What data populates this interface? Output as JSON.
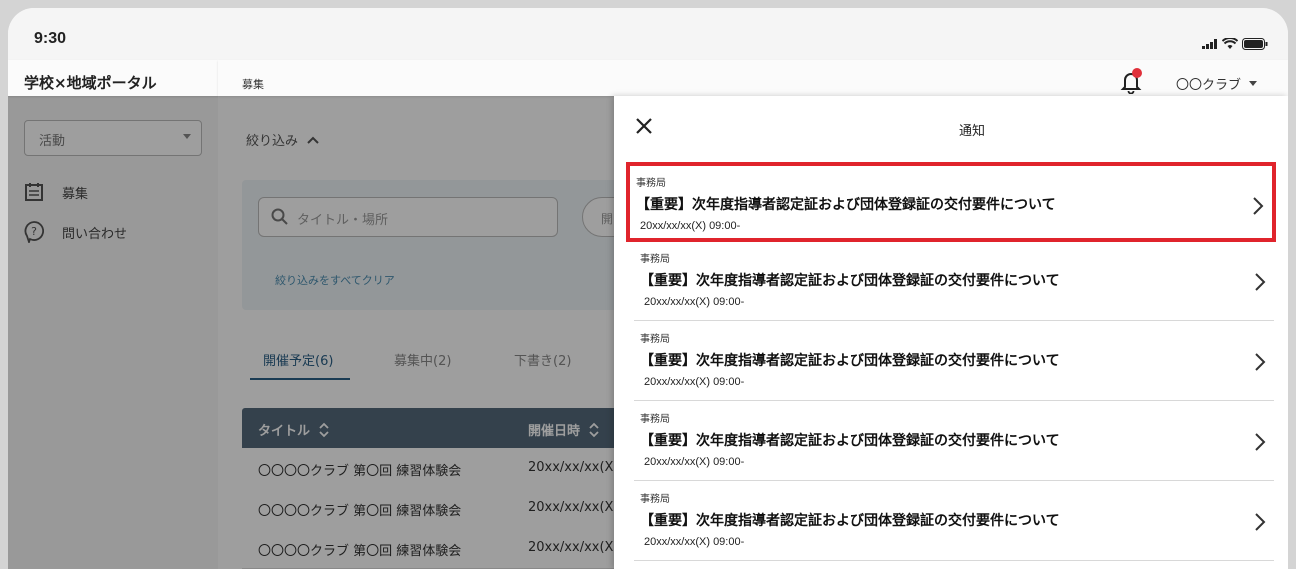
{
  "status_bar": {
    "time": "9:30"
  },
  "app": {
    "title": "学校×地域ポータル"
  },
  "sidebar": {
    "select_value": "活動",
    "items": [
      {
        "label": "募集",
        "icon": "calendar-icon"
      },
      {
        "label": "問い合わせ",
        "icon": "help-circle-icon"
      }
    ]
  },
  "header": {
    "breadcrumb": "募集",
    "account": "〇〇クラブ"
  },
  "filter": {
    "toggle_label": "絞り込み",
    "search_placeholder": "タイトル・場所",
    "pill_label": "開",
    "clear_label": "絞り込みをすべてクリア"
  },
  "tabs": [
    {
      "label": "開催予定(6)",
      "active": true
    },
    {
      "label": "募集中(2)",
      "active": false
    },
    {
      "label": "下書き(2)",
      "active": false
    }
  ],
  "table": {
    "headers": [
      "タイトル",
      "開催日時"
    ],
    "rows": [
      [
        "〇〇〇〇クラブ 第〇回 練習体験会",
        "20xx/xx/xx(X"
      ],
      [
        "〇〇〇〇クラブ 第〇回 練習体験会",
        "20xx/xx/xx(X"
      ],
      [
        "〇〇〇〇クラブ 第〇回 練習体験会",
        "20xx/xx/xx(X"
      ]
    ]
  },
  "notification_panel": {
    "title": "通知",
    "items": [
      {
        "source": "事務局",
        "title": "【重要】次年度指導者認定証および団体登録証の交付要件について",
        "date": "20xx/xx/xx(X) 09:00-",
        "selected": true
      },
      {
        "source": "事務局",
        "title": "【重要】次年度指導者認定証および団体登録証の交付要件について",
        "date": "20xx/xx/xx(X) 09:00-",
        "selected": false
      },
      {
        "source": "事務局",
        "title": "【重要】次年度指導者認定証および団体登録証の交付要件について",
        "date": "20xx/xx/xx(X) 09:00-",
        "selected": false
      },
      {
        "source": "事務局",
        "title": "【重要】次年度指導者認定証および団体登録証の交付要件について",
        "date": "20xx/xx/xx(X) 09:00-",
        "selected": false
      },
      {
        "source": "事務局",
        "title": "【重要】次年度指導者認定証および団体登録証の交付要件について",
        "date": "20xx/xx/xx(X) 09:00-",
        "selected": false
      }
    ]
  },
  "colors": {
    "accent": "#2a5f86",
    "highlight": "#e0242c",
    "notification_dot": "#e0303a",
    "table_header": "#546a7b"
  }
}
